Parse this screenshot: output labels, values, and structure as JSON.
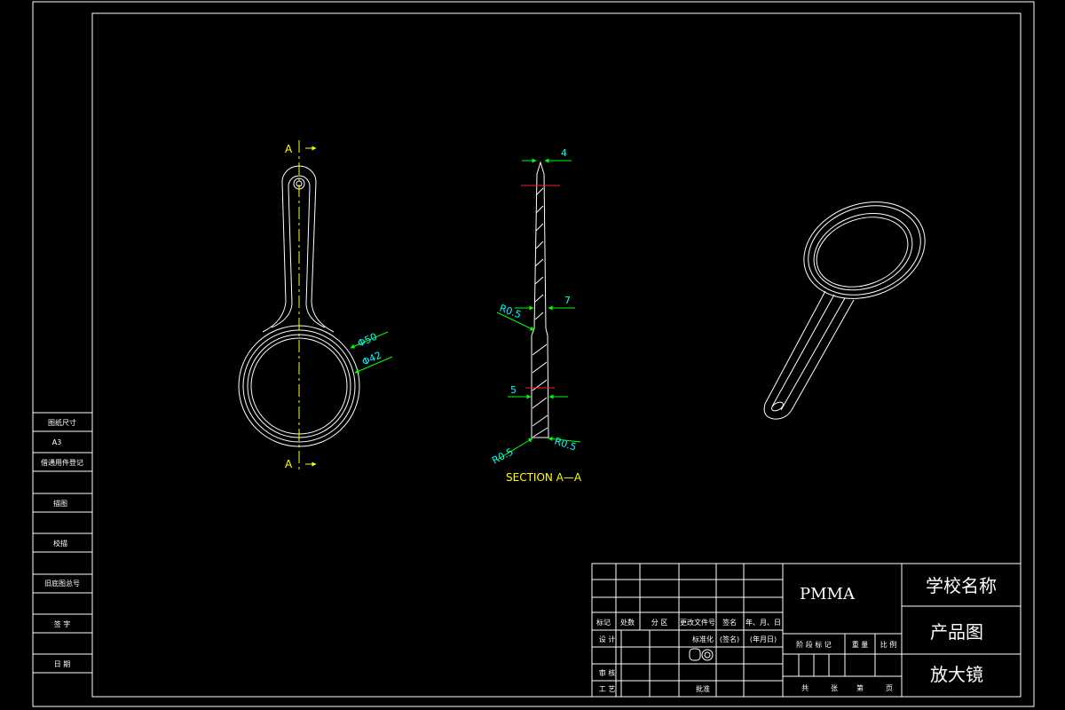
{
  "front_view": {
    "section_letter_top": "A",
    "section_letter_bottom": "A",
    "dia_outer": "Φ50",
    "dia_inner": "Φ42"
  },
  "section_view": {
    "title": "SECTION A—A",
    "dim_top": "4",
    "dim_mid": "7",
    "dim_low": "5",
    "radius_left_mid": "R0.5",
    "radius_left_bottom": "R0.5",
    "radius_right_bottom": "R0.5"
  },
  "left_strip": {
    "items": [
      "图纸尺寸",
      "A3",
      "借通用件登记",
      "",
      "描图",
      "",
      "校描",
      "",
      "旧底图总号",
      "",
      "签 字",
      "",
      "日 期"
    ]
  },
  "title_block": {
    "material": "PMMA",
    "school_name": "学校名称",
    "drawing_type": "产品图",
    "product_name": "放大镜",
    "row_headers": [
      "标记",
      "处数",
      "分 区",
      "更改文件号",
      "签名",
      "年、月、日"
    ],
    "design_label": "设 计",
    "standard_label": "标准化",
    "sign_label": "(签名)",
    "date_label": "(年月日)",
    "review_label": "审 核",
    "process_label": "工 艺",
    "approve_label": "批准",
    "stage_headers": [
      "阶 段 标 记",
      "重 量",
      "比 例"
    ],
    "sheet_labels": [
      "共",
      "张",
      "第",
      "页"
    ]
  }
}
